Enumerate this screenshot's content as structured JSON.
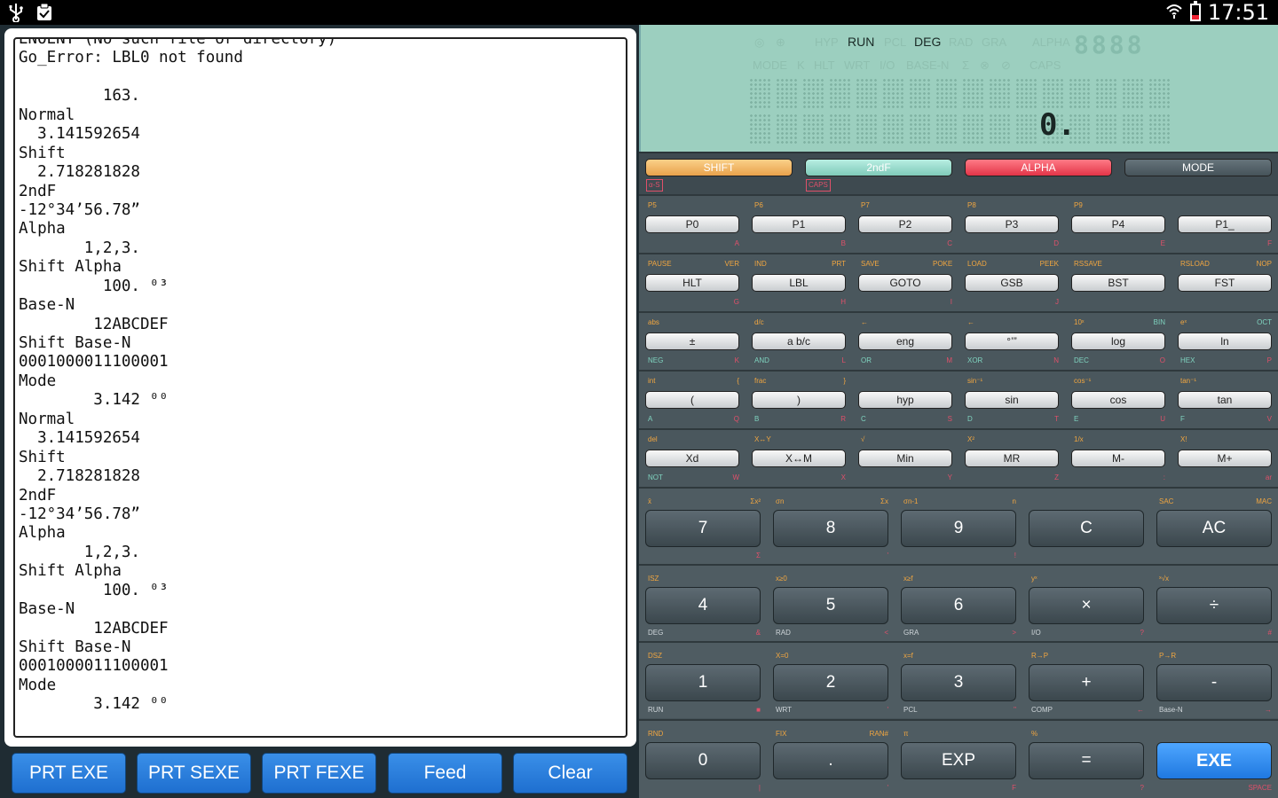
{
  "status_bar": {
    "time": "17:51",
    "icons": [
      "usb-icon",
      "clipboard-icon",
      "wifi-icon",
      "battery-icon"
    ]
  },
  "printer": {
    "lines": [
      "ENOENT (No such file or directory)",
      "Go_Error: LBL0 not found",
      "",
      "         163.",
      "Normal",
      "  3.141592654",
      "Shift",
      "  2.718281828",
      "2ndF",
      "-12°34’56.78”",
      "Alpha",
      "       1,2,3.",
      "Shift Alpha",
      "         100. ⁰³",
      "Base-N",
      "        12ABCDEF",
      "Shift Base-N",
      "0001000011100001",
      "Mode",
      "        3.142 ⁰⁰",
      "Normal",
      "  3.141592654",
      "Shift",
      "  2.718281828",
      "2ndF",
      "-12°34’56.78”",
      "Alpha",
      "       1,2,3.",
      "Shift Alpha",
      "         100. ⁰³",
      "Base-N",
      "        12ABCDEF",
      "Shift Base-N",
      "0001000011100001",
      "Mode",
      "        3.142 ⁰⁰"
    ],
    "buttons": [
      "PRT EXE",
      "PRT SEXE",
      "PRT FEXE",
      "Feed",
      "Clear"
    ]
  },
  "lcd": {
    "annunciators_off": [
      "HYP",
      "PCL",
      "RAD",
      "GRA",
      "ALPHA",
      "MODE",
      "K",
      "HLT",
      "WRT",
      "I/O",
      "BASE-N",
      "CAPS"
    ],
    "run": "RUN",
    "deg": "DEG",
    "segments": "8888",
    "display_value": "0."
  },
  "top_keys": [
    {
      "label": "SHIFT",
      "color": "#f4b85c"
    },
    {
      "label": "2ndF",
      "color": "#8fd6c8"
    },
    {
      "label": "ALPHA",
      "color": "#f0485a"
    },
    {
      "label": "MODE",
      "color": "#56636a"
    }
  ],
  "top_tags": {
    "alpha_s": "α-S",
    "caps": "CAPS"
  },
  "rows": [
    {
      "keys": [
        "P0",
        "P1",
        "P2",
        "P3",
        "P4",
        "P1_"
      ],
      "above": [
        [
          "P5",
          ""
        ],
        [
          "P6",
          ""
        ],
        [
          "P7",
          ""
        ],
        [
          "P8",
          ""
        ],
        [
          "P9",
          ""
        ],
        [
          "",
          ""
        ]
      ],
      "below": [
        [
          "",
          "A"
        ],
        [
          "",
          "B"
        ],
        [
          "",
          "C"
        ],
        [
          "",
          "D"
        ],
        [
          "",
          "E"
        ],
        [
          "",
          "F"
        ]
      ]
    },
    {
      "keys": [
        "HLT",
        "LBL",
        "GOTO",
        "GSB",
        "BST",
        "FST"
      ],
      "above": [
        [
          "PAUSE",
          "VER"
        ],
        [
          "IND",
          "PRT"
        ],
        [
          "SAVE",
          "POKE"
        ],
        [
          "LOAD",
          "PEEK"
        ],
        [
          "RSSAVE",
          ""
        ],
        [
          "RSLOAD",
          "NOP"
        ]
      ],
      "below": [
        [
          "",
          "G"
        ],
        [
          "",
          "H"
        ],
        [
          "",
          "I"
        ],
        [
          "",
          "J"
        ],
        [
          "",
          ""
        ],
        [
          "",
          ""
        ]
      ]
    },
    {
      "keys": [
        "±",
        "a b/c",
        "eng",
        "°’”",
        "log",
        "ln"
      ],
      "above": [
        [
          "abs",
          ""
        ],
        [
          "d/c",
          ""
        ],
        [
          "←",
          ""
        ],
        [
          "←",
          ""
        ],
        [
          "10ˣ",
          "BIN"
        ],
        [
          "eˣ",
          "OCT"
        ]
      ],
      "below": [
        [
          "NEG",
          "K"
        ],
        [
          "AND",
          "L"
        ],
        [
          "OR",
          "M"
        ],
        [
          "XOR",
          "N"
        ],
        [
          "DEC",
          "O"
        ],
        [
          "HEX",
          "P"
        ]
      ]
    },
    {
      "keys": [
        "(",
        ")",
        "hyp",
        "sin",
        "cos",
        "tan"
      ],
      "above": [
        [
          "int",
          "{"
        ],
        [
          "frac",
          "}"
        ],
        [
          "",
          ""
        ],
        [
          "sin⁻¹",
          ""
        ],
        [
          "cos⁻¹",
          ""
        ],
        [
          "tan⁻¹",
          ""
        ]
      ],
      "below": [
        [
          "A",
          "Q"
        ],
        [
          "B",
          "R"
        ],
        [
          "C",
          "S"
        ],
        [
          "D",
          "T"
        ],
        [
          "E",
          "U"
        ],
        [
          "F",
          "V"
        ]
      ]
    },
    {
      "keys": [
        "Xd",
        "X↔M",
        "Min",
        "MR",
        "M-",
        "M+"
      ],
      "above": [
        [
          "del",
          ""
        ],
        [
          "X↔Y",
          ""
        ],
        [
          "√",
          ""
        ],
        [
          "X²",
          ""
        ],
        [
          "1/x",
          ""
        ],
        [
          "X!",
          ""
        ]
      ],
      "below": [
        [
          "NOT",
          "W"
        ],
        [
          "",
          "X"
        ],
        [
          "",
          "Y"
        ],
        [
          "",
          "Z"
        ],
        [
          "",
          ":"
        ],
        [
          "",
          "ar"
        ]
      ]
    }
  ],
  "num_rows": [
    {
      "keys": [
        "7",
        "8",
        "9",
        "C",
        "AC"
      ],
      "above": [
        [
          "x̄",
          "Σx²"
        ],
        [
          "σn",
          "Σx"
        ],
        [
          "σn-1",
          "n"
        ],
        [
          "",
          ""
        ],
        [
          "SAC",
          "MAC"
        ]
      ],
      "below": [
        [
          "",
          "Σ"
        ],
        [
          "",
          "'"
        ],
        [
          "",
          "!"
        ],
        [
          "",
          ""
        ],
        [
          "",
          ""
        ]
      ]
    },
    {
      "keys": [
        "4",
        "5",
        "6",
        "×",
        "÷"
      ],
      "above": [
        [
          "ISZ",
          ""
        ],
        [
          "x≥0",
          ""
        ],
        [
          "x≥f",
          ""
        ],
        [
          "yˣ",
          ""
        ],
        [
          "ˣ√x",
          ""
        ]
      ],
      "below": [
        [
          "DEG",
          "&"
        ],
        [
          "RAD",
          "<"
        ],
        [
          "GRA",
          ">"
        ],
        [
          "I/O",
          "?"
        ],
        [
          "",
          "#"
        ]
      ]
    },
    {
      "keys": [
        "1",
        "2",
        "3",
        "+",
        "-"
      ],
      "above": [
        [
          "DSZ",
          ""
        ],
        [
          "X=0",
          ""
        ],
        [
          "x=f",
          ""
        ],
        [
          "R→P",
          ""
        ],
        [
          "P→R",
          ""
        ]
      ],
      "below": [
        [
          "RUN",
          "■"
        ],
        [
          "WRT",
          "'"
        ],
        [
          "PCL",
          "\""
        ],
        [
          "COMP",
          "←"
        ],
        [
          "Base-N",
          "→"
        ]
      ]
    },
    {
      "keys": [
        "0",
        ".",
        "EXP",
        "=",
        "EXE"
      ],
      "above": [
        [
          "RND",
          ""
        ],
        [
          "FIX",
          "RAN#"
        ],
        [
          "π",
          ""
        ],
        [
          "%",
          ""
        ],
        [
          "",
          ""
        ]
      ],
      "below": [
        [
          "",
          "|"
        ],
        [
          "",
          "'"
        ],
        [
          "",
          "F"
        ],
        [
          "",
          "?"
        ],
        [
          "",
          "SPACE"
        ]
      ]
    }
  ]
}
